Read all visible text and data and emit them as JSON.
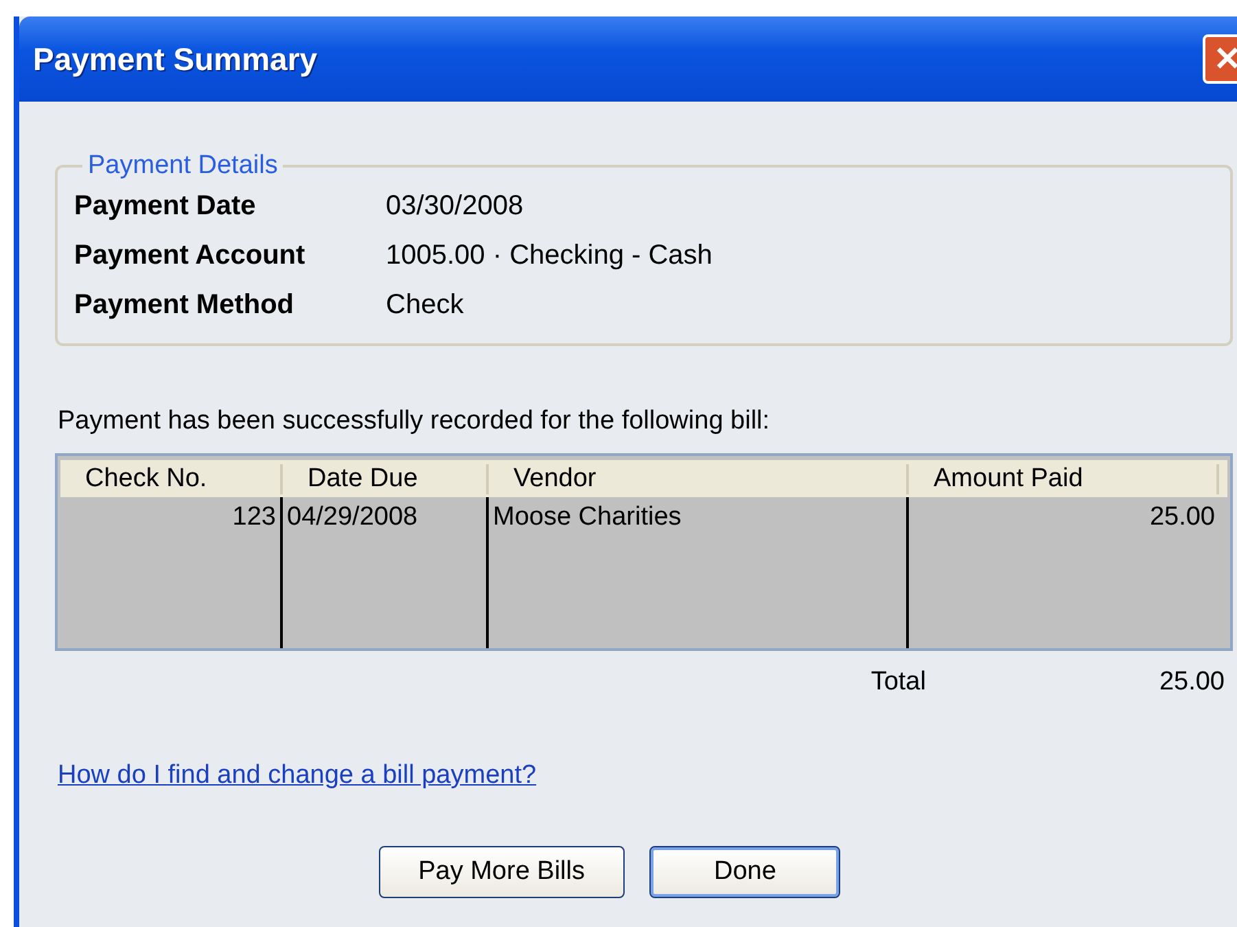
{
  "window": {
    "title": "Payment Summary",
    "close": "✕"
  },
  "details": {
    "legend": "Payment Details",
    "fields": [
      {
        "label": "Payment Date",
        "value": "03/30/2008"
      },
      {
        "label": "Payment Account",
        "value": "1005.00 · Checking - Cash"
      },
      {
        "label": "Payment Method",
        "value": "Check"
      }
    ]
  },
  "message": "Payment has been successfully recorded for the following bill:",
  "table": {
    "columns": [
      "Check No.",
      "Date Due",
      "Vendor",
      "Amount Paid"
    ],
    "rows": [
      {
        "cells": [
          "123",
          "04/29/2008",
          "Moose Charities",
          "25.00"
        ],
        "selected": true
      }
    ]
  },
  "total": {
    "label": "Total",
    "value": "25.00"
  },
  "help_link": "How do I find and change a bill payment?",
  "buttons": [
    {
      "label": "Pay More Bills",
      "default": false
    },
    {
      "label": "Done",
      "default": true
    }
  ]
}
